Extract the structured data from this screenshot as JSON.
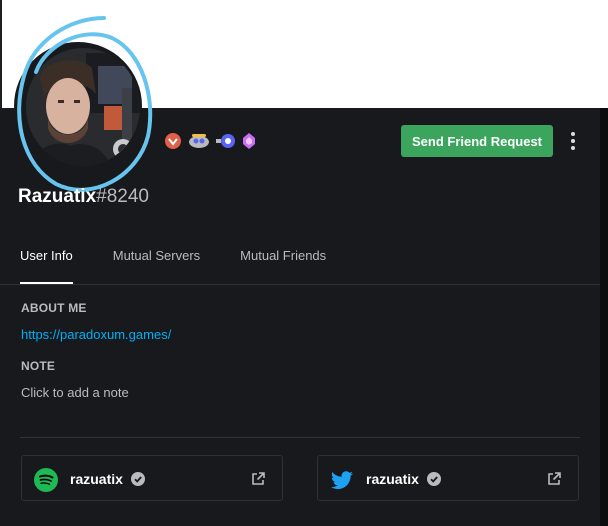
{
  "profile": {
    "username": "Razuatix",
    "discriminator": "#8240"
  },
  "actions": {
    "send_friend_request": "Send Friend Request"
  },
  "tabs": [
    {
      "label": "User Info",
      "active": true
    },
    {
      "label": "Mutual Servers",
      "active": false
    },
    {
      "label": "Mutual Friends",
      "active": false
    }
  ],
  "about": {
    "title": "ABOUT ME",
    "link": "https://paradoxum.games/"
  },
  "note": {
    "title": "NOTE",
    "placeholder": "Click to add a note"
  },
  "connections": [
    {
      "service": "spotify",
      "name": "razuatix",
      "verified": true,
      "icon": "spotify-icon"
    },
    {
      "service": "twitter",
      "name": "razuatix",
      "verified": true,
      "icon": "twitter-icon"
    }
  ],
  "badges": [
    "early-supporter-badge",
    "bug-hunter-badge",
    "hypesquad-badge",
    "nitro-boost-badge"
  ],
  "colors": {
    "accent_green": "#3ba55d",
    "link": "#00aff4",
    "background": "#18191c",
    "scribble": "#67c4ee"
  }
}
